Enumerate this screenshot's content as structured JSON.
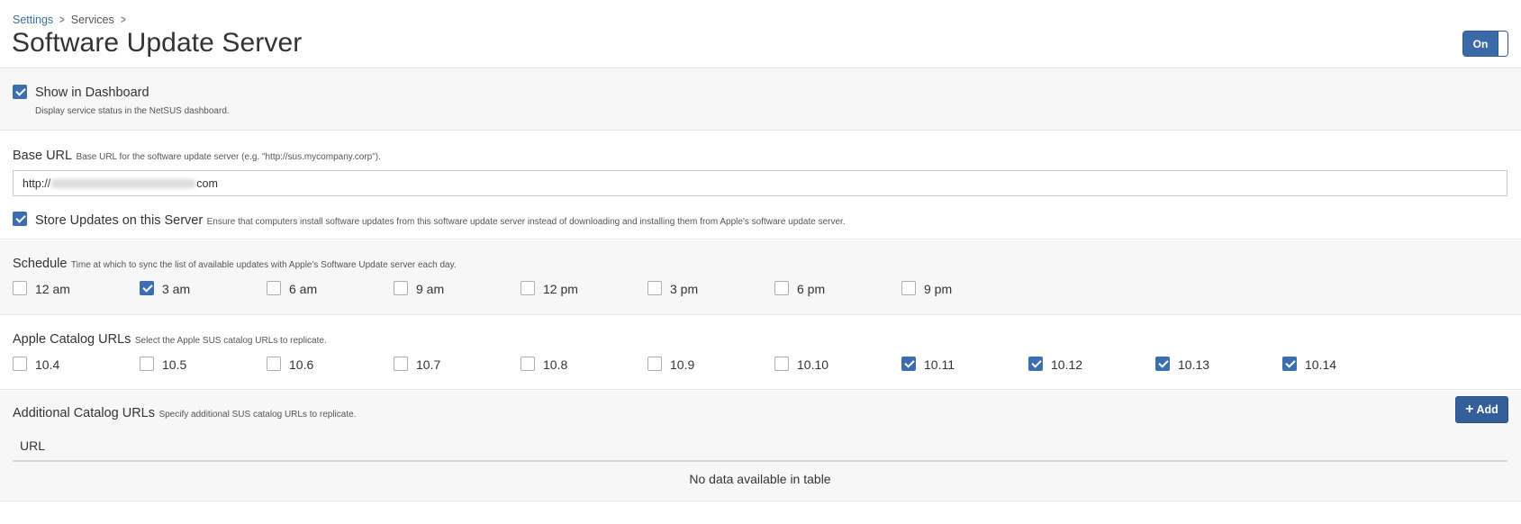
{
  "breadcrumb": {
    "settings": "Settings",
    "services": "Services"
  },
  "page": {
    "title": "Software Update Server"
  },
  "toggle": {
    "label": "On"
  },
  "dashboard": {
    "label": "Show in Dashboard",
    "help": "Display service status in the NetSUS dashboard.",
    "checked": true
  },
  "base_url": {
    "label": "Base URL",
    "help": "Base URL for the software update server (e.g. \"http://sus.mycompany.corp\").",
    "value_prefix": "http://",
    "value_suffix": "com"
  },
  "store_updates": {
    "label": "Store Updates on this Server",
    "help": "Ensure that computers install software updates from this software update server instead of downloading and installing them from Apple's software update server.",
    "checked": true
  },
  "schedule": {
    "label": "Schedule",
    "help": "Time at which to sync the list of available updates with Apple's Software Update server each day.",
    "options": [
      {
        "label": "12 am",
        "checked": false
      },
      {
        "label": "3 am",
        "checked": true
      },
      {
        "label": "6 am",
        "checked": false
      },
      {
        "label": "9 am",
        "checked": false
      },
      {
        "label": "12 pm",
        "checked": false
      },
      {
        "label": "3 pm",
        "checked": false
      },
      {
        "label": "6 pm",
        "checked": false
      },
      {
        "label": "9 pm",
        "checked": false
      }
    ]
  },
  "catalogs": {
    "label": "Apple Catalog URLs",
    "help": "Select the Apple SUS catalog URLs to replicate.",
    "options": [
      {
        "label": "10.4",
        "checked": false
      },
      {
        "label": "10.5",
        "checked": false
      },
      {
        "label": "10.6",
        "checked": false
      },
      {
        "label": "10.7",
        "checked": false
      },
      {
        "label": "10.8",
        "checked": false
      },
      {
        "label": "10.9",
        "checked": false
      },
      {
        "label": "10.10",
        "checked": false
      },
      {
        "label": "10.11",
        "checked": true
      },
      {
        "label": "10.12",
        "checked": true
      },
      {
        "label": "10.13",
        "checked": true
      },
      {
        "label": "10.14",
        "checked": true
      }
    ]
  },
  "additional": {
    "label": "Additional Catalog URLs",
    "help": "Specify additional SUS catalog URLs to replicate.",
    "add_label": "Add",
    "column_url": "URL",
    "empty_text": "No data available in table"
  },
  "colors": {
    "accent": "#3d6fb0",
    "button": "#345f99"
  },
  "icons": {
    "breadcrumb_separator": "chevron-right-icon",
    "add": "plus-icon",
    "checkbox": "check-icon"
  }
}
